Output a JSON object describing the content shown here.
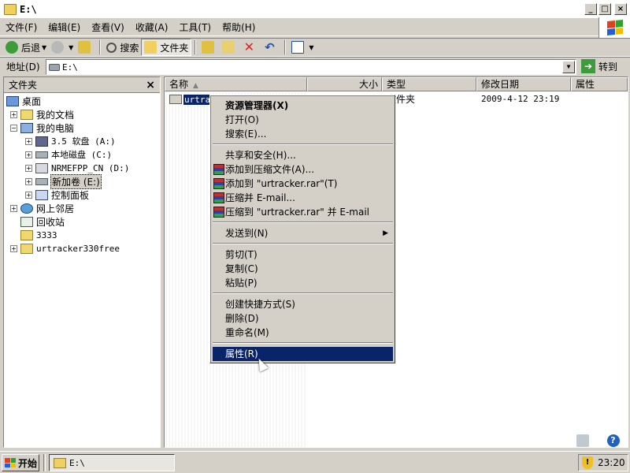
{
  "window": {
    "title": "E:\\",
    "min_glyph": "_",
    "max_glyph": "□",
    "close_glyph": "×"
  },
  "menubar": [
    "文件(F)",
    "编辑(E)",
    "查看(V)",
    "收藏(A)",
    "工具(T)",
    "帮助(H)"
  ],
  "toolbar": {
    "back": "后退",
    "search": "搜索",
    "folders": "文件夹"
  },
  "address": {
    "label": "地址(D)",
    "value": "E:\\",
    "go": "转到"
  },
  "folder_pane": {
    "title": "文件夹",
    "close_glyph": "×",
    "tree": [
      "桌面",
      "我的文档",
      "我的电脑",
      "3.5 软盘 (A:)",
      "本地磁盘 (C:)",
      "NRMEFPP_CN (D:)",
      "新加卷 (E:)",
      "控制面板",
      "网上邻居",
      "回收站",
      "3333",
      "urtracker330free"
    ],
    "expanders": {
      "plus": "+",
      "minus": "−"
    }
  },
  "list": {
    "columns": [
      "名称",
      "大小",
      "类型",
      "修改日期",
      "属性"
    ],
    "sort_indicator": "▲",
    "row": {
      "name": "urtracker",
      "type": "文件夹",
      "modified": "2009-4-12 23:19"
    }
  },
  "context_menu": {
    "items": [
      "资源管理器(X)",
      "打开(O)",
      "搜索(E)...",
      "共享和安全(H)...",
      "添加到压缩文件(A)...",
      "添加到 \"urtracker.rar\"(T)",
      "压缩并 E-mail...",
      "压缩到 \"urtracker.rar\" 并 E-mail",
      "发送到(N)",
      "剪切(T)",
      "复制(C)",
      "粘贴(P)",
      "创建快捷方式(S)",
      "删除(D)",
      "重命名(M)",
      "属性(R)"
    ],
    "submenu_arrow": "▶",
    "highlighted": "属性(R)"
  },
  "taskbar": {
    "start": "开始",
    "task": "E:\\",
    "clock": "23:20",
    "tray_glyph": "!"
  },
  "colors": {
    "face": "#d4d0c8",
    "selection": "#0a246a"
  },
  "icons": [
    "back-icon",
    "forward-icon",
    "up-folder-icon",
    "search-icon",
    "folders-icon",
    "move-to-icon",
    "copy-to-icon",
    "delete-icon",
    "undo-icon",
    "views-icon",
    "windows-logo-icon"
  ]
}
